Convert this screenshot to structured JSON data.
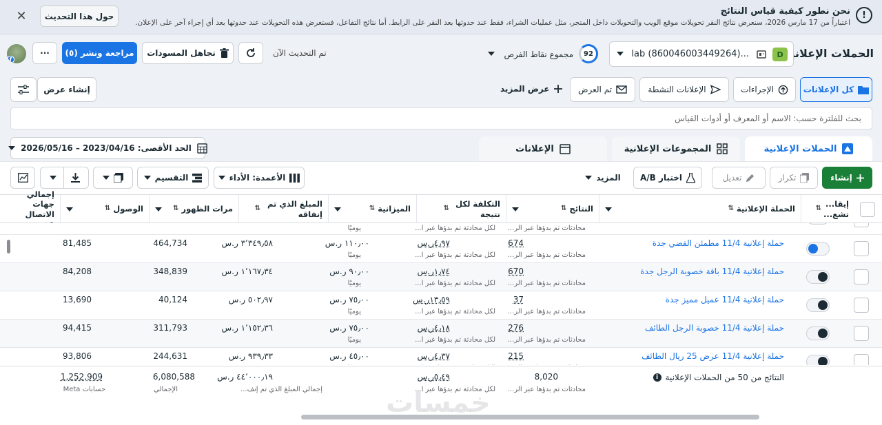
{
  "banner": {
    "title": "نحن نطور كيفية قياس النتائج",
    "desc": "اعتباراً من 17 مارس 2026، سنعرض نتائج النقر تحويلات موقع الويب والتحويلات داخل المتجر، مثل عمليات الشراء، فقط عند حدوثها بعد النقر على الرابط. أما نتائج التفاعل، فستعرض هذه التحويلات عند حدوثها بعد أي إجراء آخر على الإعلان.",
    "about_button": "حول هذا التحديث",
    "close": "✕"
  },
  "header": {
    "page_title": "الحملات الإعلانية",
    "account_badge": "D",
    "account_name": "lab (860046003449264)...",
    "opportunity_score": "92",
    "opportunity_label": "مجموع نقاط الفرص",
    "updated": "تم التحديث الآن",
    "discard": "تجاهل المسودات",
    "review_publish": "مراجعة ونشر (٥)",
    "more": "···"
  },
  "view_tabs": {
    "all_ads": "كل الإعلانات",
    "actions": "الإجراءات",
    "active_ads": "الإعلانات النشطة",
    "shown": "تم العرض",
    "show_more": "عرض المزيد",
    "create_view": "إنشاء عرض"
  },
  "search": {
    "placeholder": "بحث للفلترة حسب: الاسم أو المعرف أو أدوات القياس"
  },
  "level_tabs": {
    "campaigns": "الحملات الإعلانية",
    "adsets": "المجموعات الإعلانية",
    "ads": "الإعلانات"
  },
  "date_range": "الحد الأقصى: 2023/04/16 – 2026/05/16",
  "actions": {
    "create": "إنشاء",
    "duplicate": "تكرار",
    "edit": "تعديل",
    "ab_test": "اختبار A/B",
    "more": "المزيد",
    "columns": "الأعمدة: الأداء",
    "breakdown": "التقسيم"
  },
  "columns": {
    "off_on": "إيقا... تشغ...",
    "campaign": "الحملة الإعلانية",
    "results": "النتائج",
    "cost_per_result": "التكلفة لكل نتيجة",
    "budget": "الميزانية",
    "amount_spent": "المبلغ الذي تم إنفاقه",
    "impressions": "مرات الظهور",
    "reach": "الوصول",
    "total_contacts": "إجمالي جهات الاتصال عبر..."
  },
  "partial_row": {
    "results_sub": "محادثات تم بدؤها عبر الر...",
    "cost_sub": "لكل محادثة تم بدؤها عبر ا...",
    "budget_sub": "يوميًا"
  },
  "rows": [
    {
      "name": "حملة إعلانية 11/4 مطمئن الفضي جدة",
      "state": "on",
      "results": "674",
      "results_sub": "محادثات تم بدؤها عبر الر...",
      "cost": "٤٫٩٧ر.س",
      "cost_sub": "لكل محادثة تم بدؤها عبر ا...",
      "budget": "١١٠٫٠٠ ر.س",
      "budget_sub": "يوميًا",
      "spent": "٣٬٣٤٩٫٥٨ ر.س",
      "impressions": "464,734",
      "reach": "81,485"
    },
    {
      "name": "حملة إعلانية 11/4 باقة خصوبة الرجل جدة",
      "state": "off",
      "results": "670",
      "results_sub": "محادثات تم بدؤها عبر الر...",
      "cost": "١٫٧٤ر.س",
      "cost_sub": "لكل محادثة تم بدؤها عبر ا...",
      "budget": "٩٠٫٠٠ ر.س",
      "budget_sub": "يوميًا",
      "spent": "١٬١٦٧٫٣٤ ر.س",
      "impressions": "348,839",
      "reach": "84,208"
    },
    {
      "name": "حملة إعلانية 11/4 عميل مميز جدة",
      "state": "off",
      "results": "37",
      "results_sub": "محادثات تم بدؤها عبر الر...",
      "cost": "١٣٫٥٩ر.س",
      "cost_sub": "لكل محادثة تم بدؤها عبر ا...",
      "budget": "٧٥٫٠٠ ر.س",
      "budget_sub": "يوميًا",
      "spent": "٥٠٢٫٩٧ ر.س",
      "impressions": "40,124",
      "reach": "13,690"
    },
    {
      "name": "حملة إعلانية 11/4 خصوبة الرجل الطائف",
      "state": "off",
      "results": "276",
      "results_sub": "محادثات تم بدؤها عبر الر...",
      "cost": "٤٫١٨ر.س",
      "cost_sub": "لكل محادثة تم بدؤها عبر ا...",
      "budget": "٧٥٫٠٠ ر.س",
      "budget_sub": "يوميًا",
      "spent": "١٬١٥٢٫٣٦ ر.س",
      "impressions": "311,793",
      "reach": "94,415"
    },
    {
      "name": "حملة إعلانية 11/4 عرض 25 ريال الطائف",
      "state": "off",
      "results": "215",
      "results_sub": "محادثات تم بدؤها عبر الر...",
      "cost": "٤٫٣٧ر.س",
      "cost_sub": "لكل محادثة تم بدؤها عبر ا...",
      "budget": "٤٥٫٠٠ ر.س",
      "budget_sub": "يوميًا",
      "spent": "٩٣٩٫٣٣ ر.س",
      "impressions": "244,631",
      "reach": "93,806"
    }
  ],
  "totals": {
    "label": "النتائج من 50 من الحملات الإعلانية",
    "results": "8,020",
    "results_sub": "محادثات تم بدؤها عبر الر...",
    "cost": "٥٫٤٩ر.س",
    "cost_sub": "لكل محادثة تم بدؤها عبر ا...",
    "spent": "٤٤٬٠٠٠٫١٩ ر.س",
    "spent_sub": "إجمالي المبلغ الذي تم إنف...",
    "impressions": "6,080,588",
    "impressions_sub": "الإجمالي",
    "reach": "1,252,909",
    "reach_sub": "حسابات Meta"
  },
  "watermark": "خمسات",
  "colors": {
    "accent": "#1b74e4",
    "create": "#1a7f37"
  }
}
